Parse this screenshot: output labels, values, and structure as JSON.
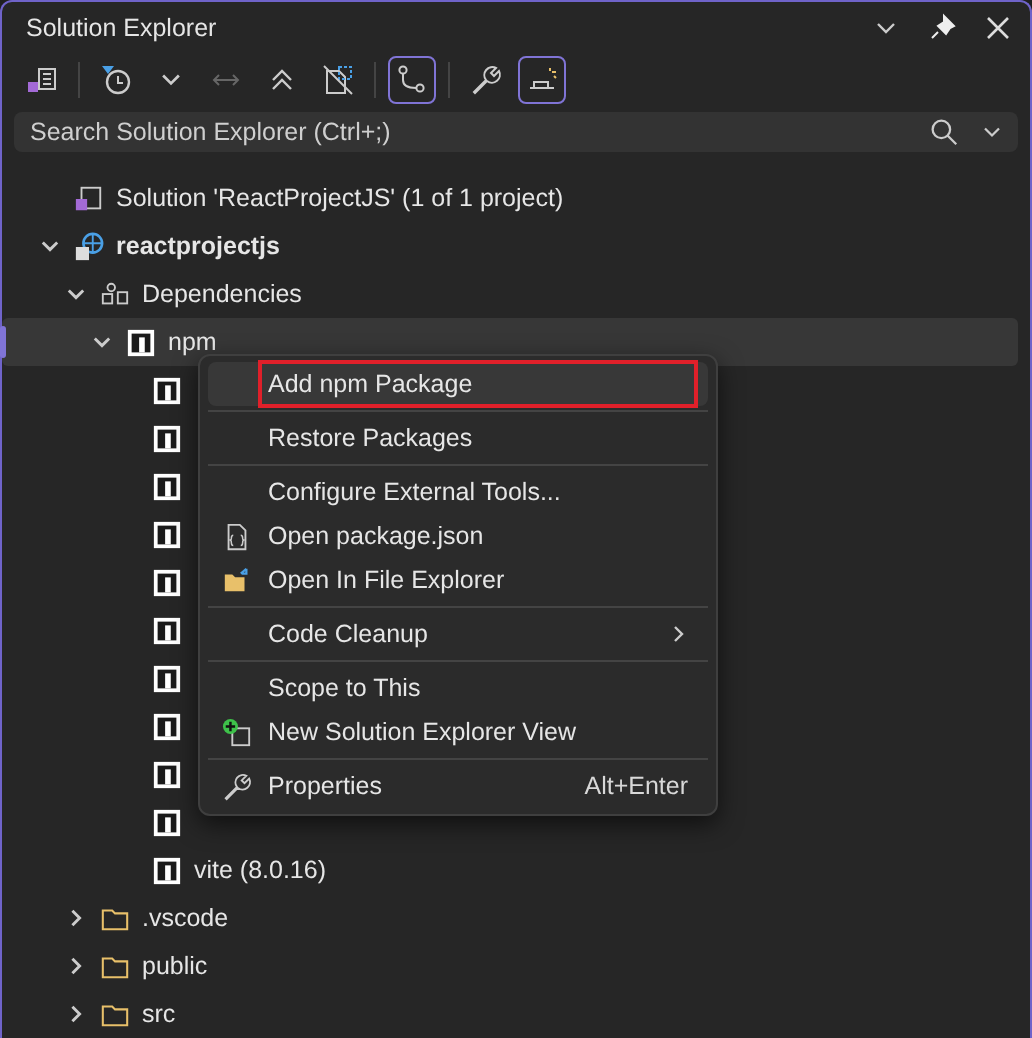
{
  "window": {
    "title": "Solution Explorer"
  },
  "toolbar": [
    {
      "kind": "home",
      "on": false
    },
    {
      "kind": "sep"
    },
    {
      "kind": "history",
      "on": false
    },
    {
      "kind": "caret",
      "on": false
    },
    {
      "kind": "sync",
      "on": false
    },
    {
      "kind": "collapse",
      "on": false
    },
    {
      "kind": "hidden-files",
      "on": false
    },
    {
      "kind": "sep"
    },
    {
      "kind": "git",
      "on": true
    },
    {
      "kind": "sep"
    },
    {
      "kind": "wrench",
      "on": false
    },
    {
      "kind": "preview",
      "on": true
    }
  ],
  "search": {
    "placeholder": "Search Solution Explorer (Ctrl+;)"
  },
  "tree": [
    {
      "kind": "solution",
      "label": "Solution 'ReactProjectJS' (1 of 1 project)",
      "selected": false,
      "children": [
        {
          "kind": "project",
          "label": "reactprojectjs",
          "selected": false,
          "expanded": true,
          "children": [
            {
              "kind": "dependencies",
              "label": "Dependencies",
              "selected": false,
              "expanded": true,
              "children": [
                {
                  "kind": "npm",
                  "label": "npm",
                  "selected": true,
                  "expanded": true,
                  "children": [
                    {
                      "kind": "package",
                      "selected": false
                    },
                    {
                      "kind": "package",
                      "selected": false
                    },
                    {
                      "kind": "package",
                      "selected": false
                    },
                    {
                      "kind": "package",
                      "selected": false
                    },
                    {
                      "kind": "package",
                      "selected": false
                    },
                    {
                      "kind": "package",
                      "selected": false
                    },
                    {
                      "kind": "package",
                      "selected": false
                    },
                    {
                      "kind": "package",
                      "selected": false
                    },
                    {
                      "kind": "package",
                      "selected": false
                    },
                    {
                      "kind": "package",
                      "selected": false
                    },
                    {
                      "kind": "package",
                      "label": "vite (8.0.16)",
                      "selected": false
                    }
                  ]
                }
              ]
            },
            {
              "kind": "folder",
              "label": ".vscode",
              "selected": false,
              "expanded": false
            },
            {
              "kind": "folder",
              "label": "public",
              "selected": false,
              "expanded": false
            },
            {
              "kind": "folder",
              "label": "src",
              "selected": false,
              "expanded": false
            }
          ]
        }
      ]
    }
  ],
  "context_menu": [
    {
      "kind": "item",
      "label": "Add npm Package",
      "selected": true
    },
    {
      "kind": "separator"
    },
    {
      "kind": "item",
      "label": "Restore Packages",
      "selected": false
    },
    {
      "kind": "separator"
    },
    {
      "kind": "item",
      "label": "Configure External Tools...",
      "selected": false
    },
    {
      "kind": "json",
      "label": "Open package.json",
      "selected": false
    },
    {
      "kind": "folder",
      "label": "Open In File Explorer",
      "selected": false
    },
    {
      "kind": "separator"
    },
    {
      "kind": "submenu",
      "label": "Code Cleanup",
      "selected": false
    },
    {
      "kind": "separator"
    },
    {
      "kind": "item",
      "label": "Scope to This",
      "selected": false
    },
    {
      "kind": "new-view",
      "label": "New Solution Explorer View",
      "selected": false
    },
    {
      "kind": "separator"
    },
    {
      "kind": "wrench",
      "label": "Properties",
      "shortcut": "Alt+Enter",
      "selected": false
    }
  ]
}
